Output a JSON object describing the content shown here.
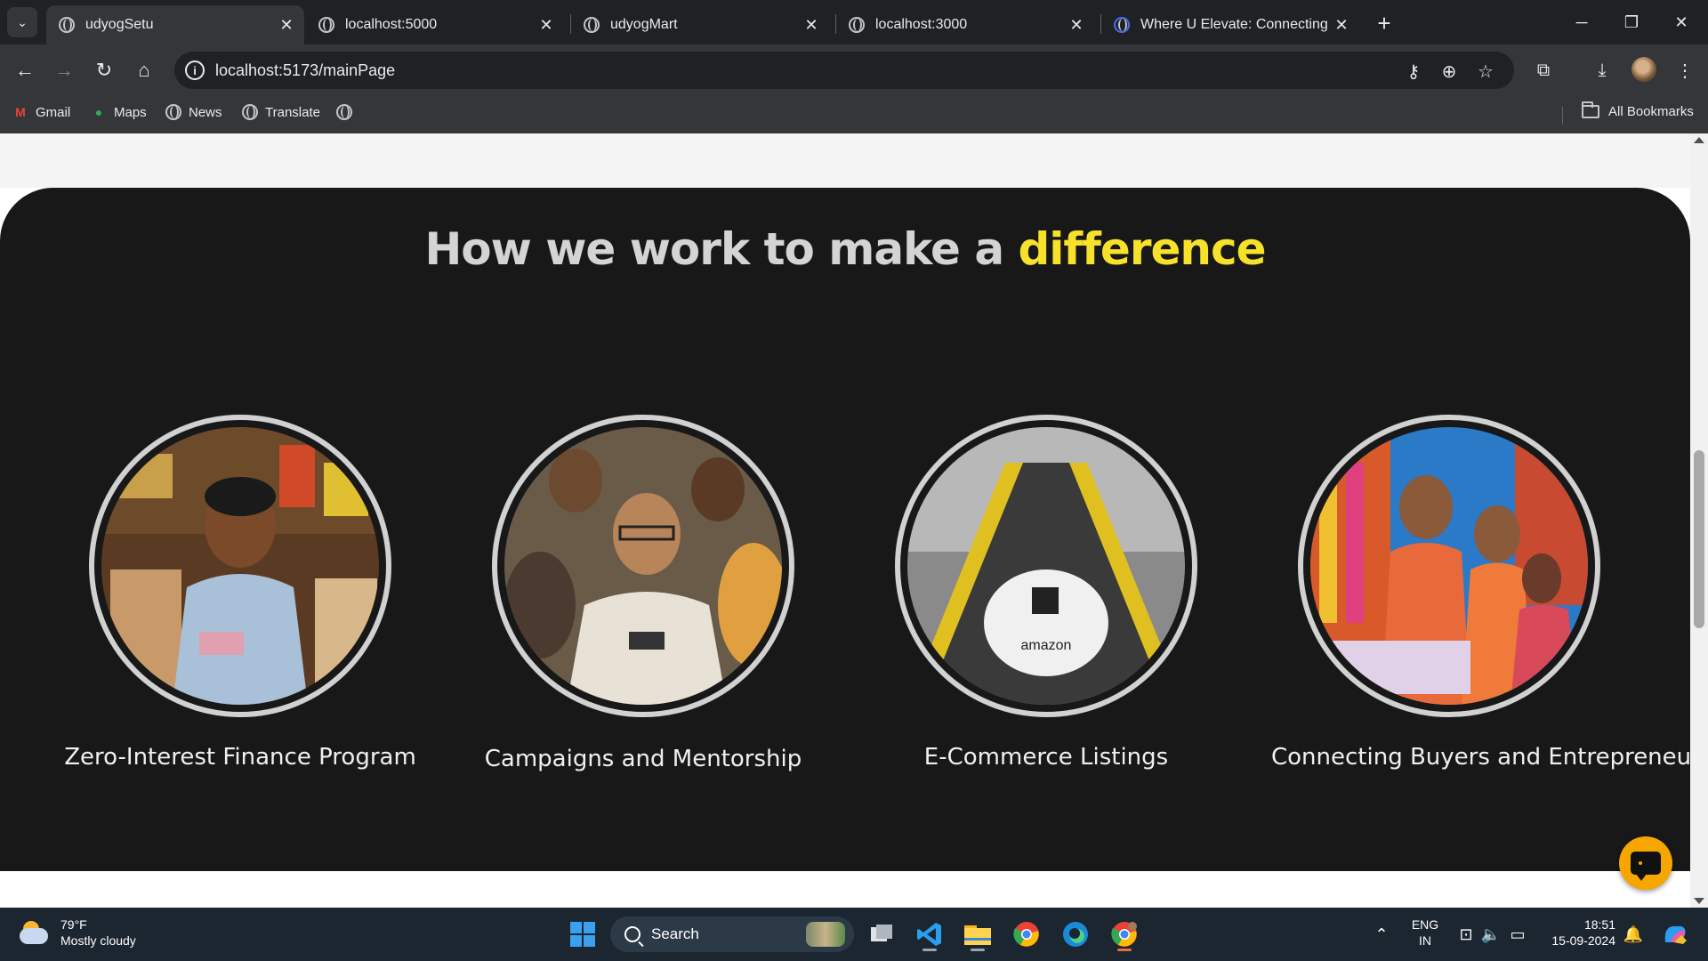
{
  "browser": {
    "tabs": [
      {
        "title": "udyogSetu",
        "active": true
      },
      {
        "title": "localhost:5000",
        "active": false
      },
      {
        "title": "udyogMart",
        "active": false
      },
      {
        "title": "localhost:3000",
        "active": false
      },
      {
        "title": "Where U Elevate: Connecting n",
        "active": false
      }
    ],
    "url": "localhost:5173/mainPage",
    "bookmarks": [
      "Gmail",
      "Maps",
      "News",
      "Translate"
    ],
    "all_bookmarks_label": "All Bookmarks"
  },
  "page": {
    "title_main": "How we work to make a ",
    "title_highlight": "difference",
    "highlight_color": "#f7e12a",
    "cards": [
      {
        "label": "Zero-Interest Finance Program",
        "image": "shopkeeper-holding-cash"
      },
      {
        "label": "Campaigns and Mentorship",
        "image": "group-mentorship-smiling-men"
      },
      {
        "label": "E-Commerce Listings",
        "image": "amazon-package-on-conveyor"
      },
      {
        "label": "Connecting Buyers and Entrepreneurs",
        "image": "family-buying-at-shop"
      }
    ]
  },
  "taskbar": {
    "weather_temp": "79°F",
    "weather_desc": "Mostly cloudy",
    "search_placeholder": "Search",
    "lang_top": "ENG",
    "lang_bottom": "IN",
    "time": "18:51",
    "date": "15-09-2024"
  }
}
